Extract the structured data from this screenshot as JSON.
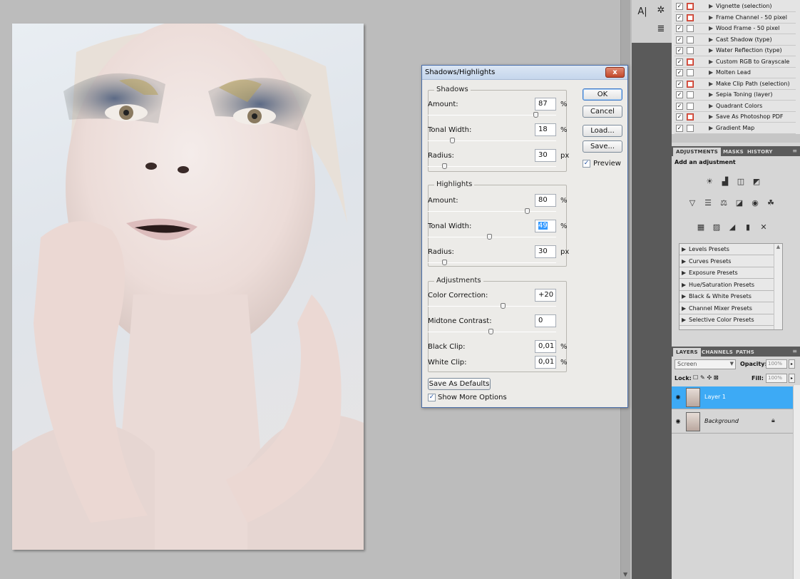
{
  "dialog": {
    "title": "Shadows/Highlights",
    "close_label": "x",
    "shadows": {
      "legend": "Shadows",
      "rows": [
        {
          "label": "Amount:",
          "value": "87",
          "unit": "%",
          "level": 0.87
        },
        {
          "label": "Tonal Width:",
          "value": "18",
          "unit": "%",
          "level": 0.18
        },
        {
          "label": "Radius:",
          "value": "30",
          "unit": "px",
          "level": 0.12
        }
      ]
    },
    "highlights": {
      "legend": "Highlights",
      "rows": [
        {
          "label": "Amount:",
          "value": "80",
          "unit": "%",
          "level": 0.8
        },
        {
          "label": "Tonal Width:",
          "value": "49",
          "unit": "%",
          "level": 0.49
        },
        {
          "label": "Radius:",
          "value": "30",
          "unit": "px",
          "level": 0.12
        }
      ]
    },
    "adjustments": {
      "legend": "Adjustments",
      "color_correction_label": "Color Correction:",
      "color_correction_value": "+20",
      "color_correction_level": 0.6,
      "midtone_label": "Midtone Contrast:",
      "midtone_value": "0",
      "midtone_level": 0.5,
      "black_clip_label": "Black Clip:",
      "black_clip_value": "0,01",
      "black_clip_unit": "%",
      "white_clip_label": "White Clip:",
      "white_clip_value": "0,01",
      "white_clip_unit": "%"
    },
    "buttons": {
      "ok": "OK",
      "cancel": "Cancel",
      "load": "Load...",
      "save": "Save..."
    },
    "preview_label": "Preview",
    "preview_checked": true,
    "save_defaults": "Save As Defaults",
    "show_more_label": "Show More Options",
    "show_more_checked": true
  },
  "actions_panel": {
    "items": [
      {
        "label": "Vignette (selection)",
        "dialog": true
      },
      {
        "label": "Frame Channel - 50 pixel",
        "dialog": true
      },
      {
        "label": "Wood Frame - 50 pixel",
        "dialog": false
      },
      {
        "label": "Cast Shadow (type)",
        "dialog": false
      },
      {
        "label": "Water Reflection (type)",
        "dialog": false
      },
      {
        "label": "Custom RGB to Grayscale",
        "dialog": true
      },
      {
        "label": "Molten Lead",
        "dialog": false
      },
      {
        "label": "Make Clip Path (selection)",
        "dialog": true
      },
      {
        "label": "Sepia Toning (layer)",
        "dialog": false
      },
      {
        "label": "Quadrant Colors",
        "dialog": false
      },
      {
        "label": "Save As Photoshop PDF",
        "dialog": true
      },
      {
        "label": "Gradient Map",
        "dialog": false
      }
    ]
  },
  "adjustments_panel": {
    "tabs": [
      "ADJUSTMENTS",
      "MASKS",
      "HISTORY"
    ],
    "heading": "Add an adjustment",
    "presets": [
      "Levels Presets",
      "Curves Presets",
      "Exposure Presets",
      "Hue/Saturation Presets",
      "Black & White Presets",
      "Channel Mixer Presets",
      "Selective Color Presets"
    ]
  },
  "layers_panel": {
    "tabs": [
      "LAYERS",
      "CHANNELS",
      "PATHS"
    ],
    "blend_mode": "Screen",
    "opacity_label": "Opacity:",
    "opacity_value": "100%",
    "lock_label": "Lock:",
    "fill_label": "Fill:",
    "fill_value": "100%",
    "layers": [
      {
        "name": "Layer 1",
        "active": true,
        "locked": false
      },
      {
        "name": "Background",
        "active": false,
        "locked": true
      }
    ]
  },
  "colors": {
    "accent": "#3daaf5",
    "dialog_border": "#4a6ea9",
    "close_red": "#c34a2c"
  }
}
